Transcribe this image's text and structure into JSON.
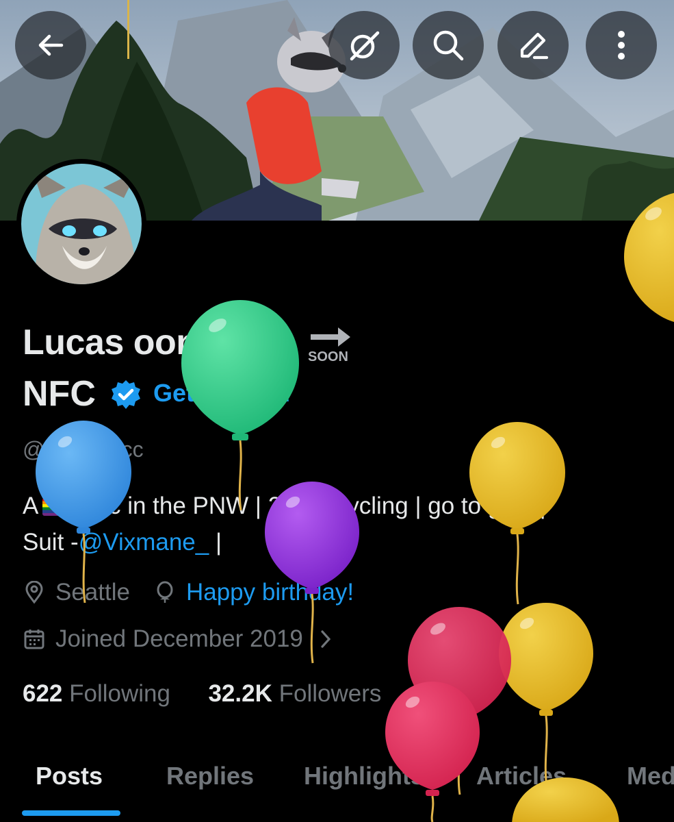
{
  "header": {
    "back_icon": "arrow-left-icon",
    "grok_icon": "grok-slash-icon",
    "search_icon": "search-icon",
    "edit_icon": "edit-pencil-icon",
    "more_icon": "more-vertical-icon"
  },
  "profile": {
    "name_line1": "Lucas oonRacc",
    "soon_label": "SOON",
    "name_line2": "NFC",
    "get_verified": "Get Verified",
    "handle": "@ooonRacc",
    "bio": {
      "p1": "A",
      "p2": "racc in the PNW | 24 |",
      "p3": "cycling | go to gym |",
      "p4": "Suit -",
      "mention": "@Vixmane_",
      "p5": "|"
    },
    "location": "Seattle",
    "birthday": "Happy birthday!",
    "joined": "Joined December 2019",
    "following_count": "622",
    "following_label": "Following",
    "followers_count": "32.2K",
    "followers_label": "Followers"
  },
  "tabs": [
    {
      "label": "Posts"
    },
    {
      "label": "Replies"
    },
    {
      "label": "Highlights"
    },
    {
      "label": "Articles"
    },
    {
      "label": "Media"
    }
  ],
  "colors": {
    "accent": "#1d9bf0",
    "background": "#000000",
    "text_primary": "#e7e9ea",
    "text_secondary": "#71767b"
  }
}
